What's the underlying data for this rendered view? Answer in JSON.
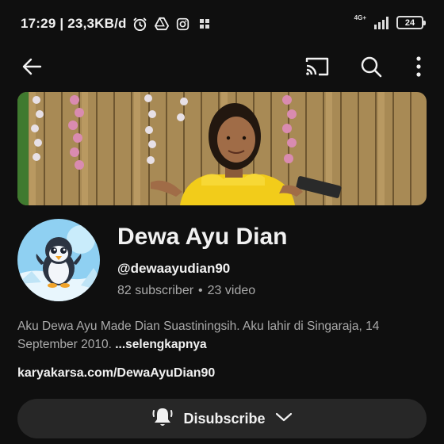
{
  "status_bar": {
    "time_speed": "17:29 | 23,3KB/d",
    "network": "4G+",
    "battery": "24"
  },
  "app_bar": {
    "icons": [
      "back-arrow-icon",
      "cast-icon",
      "search-icon",
      "more-vert-icon"
    ]
  },
  "channel": {
    "name": "Dewa Ayu Dian",
    "handle": "@dewaayudian90",
    "subscribers": "82 subscriber",
    "separator": "•",
    "videos": "23 video",
    "description": "Aku Dewa Ayu Made Dian Suastiningsih. Aku lahir di Singaraja, 14 September 2010.",
    "more_label": "...selengkapnya",
    "link": "karyakarsa.com/DewaAyuDian90"
  },
  "subscribe_button": {
    "label": "Disubscribe"
  },
  "colors": {
    "background": "#0f0f0f",
    "button_bg": "#272727",
    "text_primary": "#f1f1f1",
    "text_secondary": "#aaaaaa"
  }
}
